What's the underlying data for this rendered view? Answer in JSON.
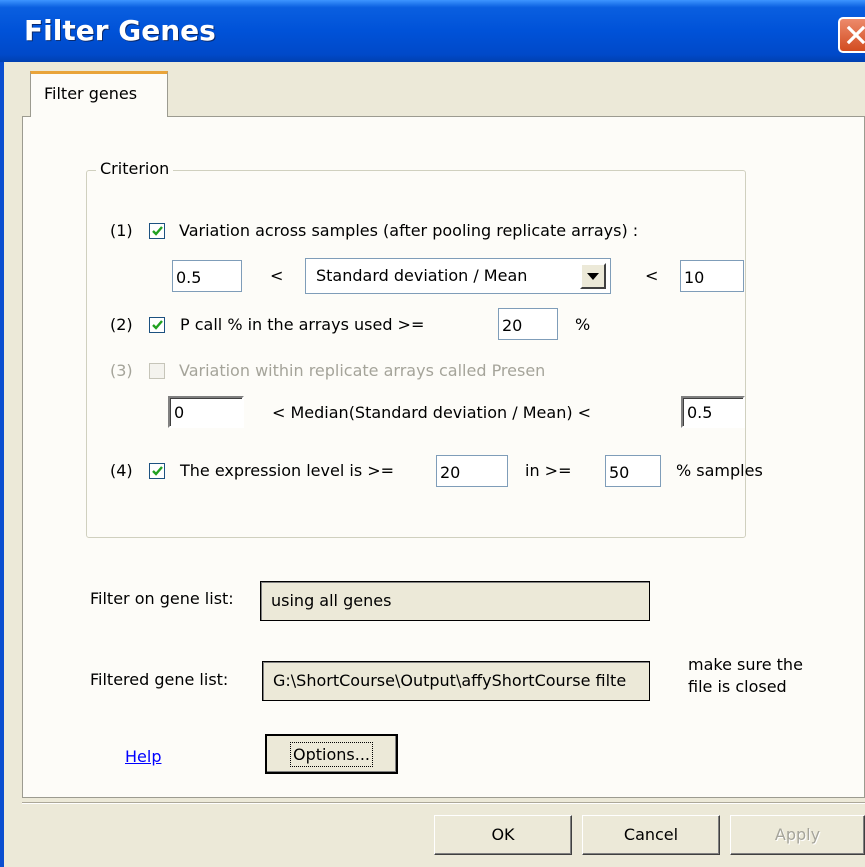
{
  "window": {
    "title": "Filter Genes",
    "close_icon": "close-icon"
  },
  "tabs": [
    {
      "label": "Filter genes",
      "active": true
    }
  ],
  "criterion": {
    "group_label": "Criterion",
    "c1": {
      "index": "(1)",
      "checked": true,
      "label": "Variation across samples (after pooling replicate arrays) :",
      "low": "0.5",
      "lt1": "<",
      "measure": "Standard deviation / Mean",
      "lt2": "<",
      "high": "10"
    },
    "c2": {
      "index": "(2)",
      "checked": true,
      "label": "P call % in the arrays used >=",
      "value": "20",
      "unit": "%"
    },
    "c3": {
      "index": "(3)",
      "checked": false,
      "enabled": false,
      "label": "Variation within replicate arrays called Presen",
      "low": "0",
      "middle": "< Median(Standard deviation / Mean) <",
      "high": "0.5"
    },
    "c4": {
      "index": "(4)",
      "checked": true,
      "label": "The expression level is >=",
      "level": "20",
      "in_label": "in >=",
      "percent": "50",
      "suffix": "% samples"
    }
  },
  "filter_on": {
    "label": "Filter on gene list:",
    "value": "using all genes"
  },
  "filtered": {
    "label": "Filtered gene list:",
    "value": "G:\\ShortCourse\\Output\\affyShortCourse filte",
    "note_line1": "make sure the",
    "note_line2": "file is closed"
  },
  "help_link": "Help",
  "options_button": "Options...",
  "footer": {
    "ok": "OK",
    "cancel": "Cancel",
    "apply": "Apply"
  }
}
